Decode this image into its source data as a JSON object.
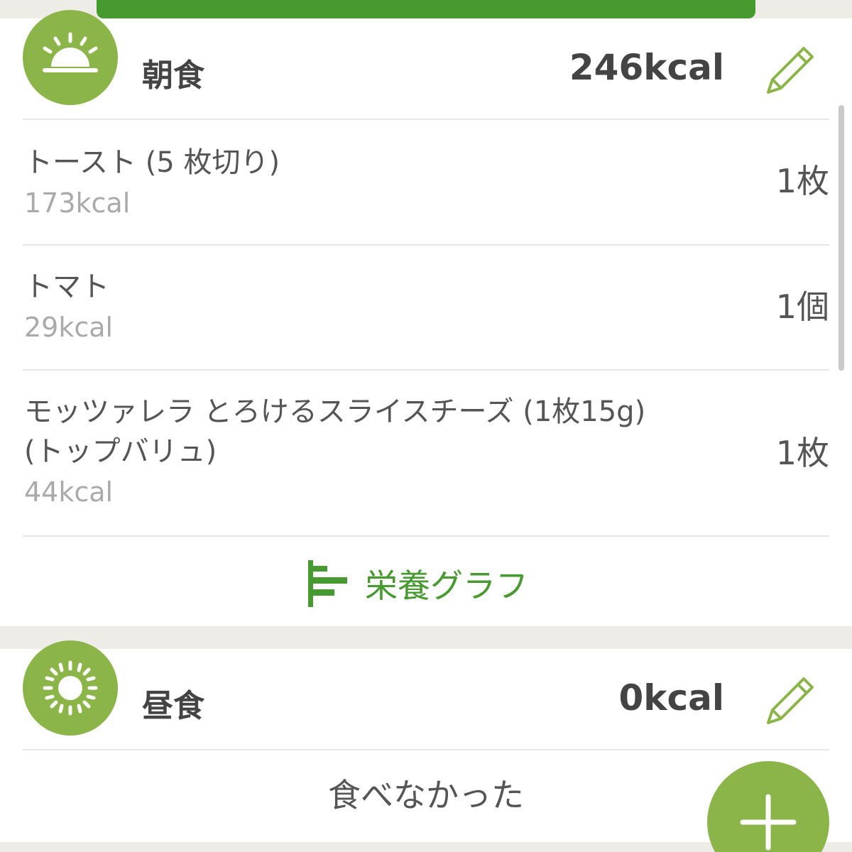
{
  "breakfast": {
    "title": "朝食",
    "kcal": "246kcal",
    "icon": "sunrise-icon",
    "items": [
      {
        "name": "トースト (5 枚切り)",
        "kcal": "173kcal",
        "qty": "1枚"
      },
      {
        "name": "トマト",
        "kcal": "29kcal",
        "qty": "1個"
      },
      {
        "name_line1": "モッツァレラ とろけるスライスチーズ (1枚15g)",
        "name_line2": "(トップバリュ)",
        "kcal": "44kcal",
        "qty": "1枚"
      }
    ],
    "nutrition_label": "栄養グラフ"
  },
  "lunch": {
    "title": "昼食",
    "kcal": "0kcal",
    "icon": "sun-icon",
    "empty_label": "食べなかった"
  },
  "icons": {
    "edit": "pencil-icon",
    "nutrition": "bar-chart-icon",
    "add": "plus-icon"
  },
  "colors": {
    "accent_green": "#479a2f",
    "icon_green": "#8cb549",
    "background": "#eeece6"
  }
}
